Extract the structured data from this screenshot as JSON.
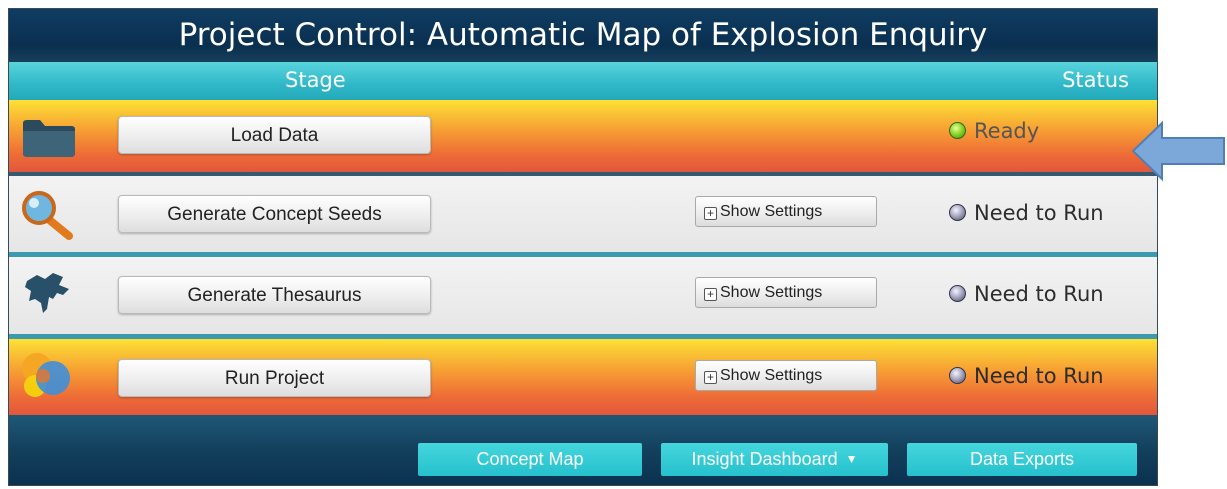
{
  "window": {
    "title": "Project Control: Automatic Map of Explosion Enquiry"
  },
  "header": {
    "stage_label": "Stage",
    "status_label": "Status"
  },
  "stages": [
    {
      "button_label": "Load Data",
      "icon": "folder-icon",
      "status": "Ready",
      "status_color": "green",
      "settings": false
    },
    {
      "button_label": "Generate Concept Seeds",
      "icon": "magnifier-icon",
      "status": "Need to Run",
      "status_color": "grey",
      "settings": true,
      "settings_label": "Show Settings"
    },
    {
      "button_label": "Generate Thesaurus",
      "icon": "thesaurus-map-icon",
      "status": "Need to Run",
      "status_color": "grey",
      "settings": true,
      "settings_label": "Show Settings"
    },
    {
      "button_label": "Run Project",
      "icon": "circles-icon",
      "status": "Need to Run",
      "status_color": "grey",
      "settings": true,
      "settings_label": "Show Settings"
    }
  ],
  "footer": {
    "concept_map": "Concept Map",
    "insight_dashboard": "Insight Dashboard",
    "data_exports": "Data Exports"
  },
  "colors": {
    "title_bg": "#0a2f4f",
    "header_bg": "#30b8c8",
    "orange_row": "#ee6d36",
    "footer_button": "#25c1cc",
    "arrow": "#7ba7d9"
  }
}
